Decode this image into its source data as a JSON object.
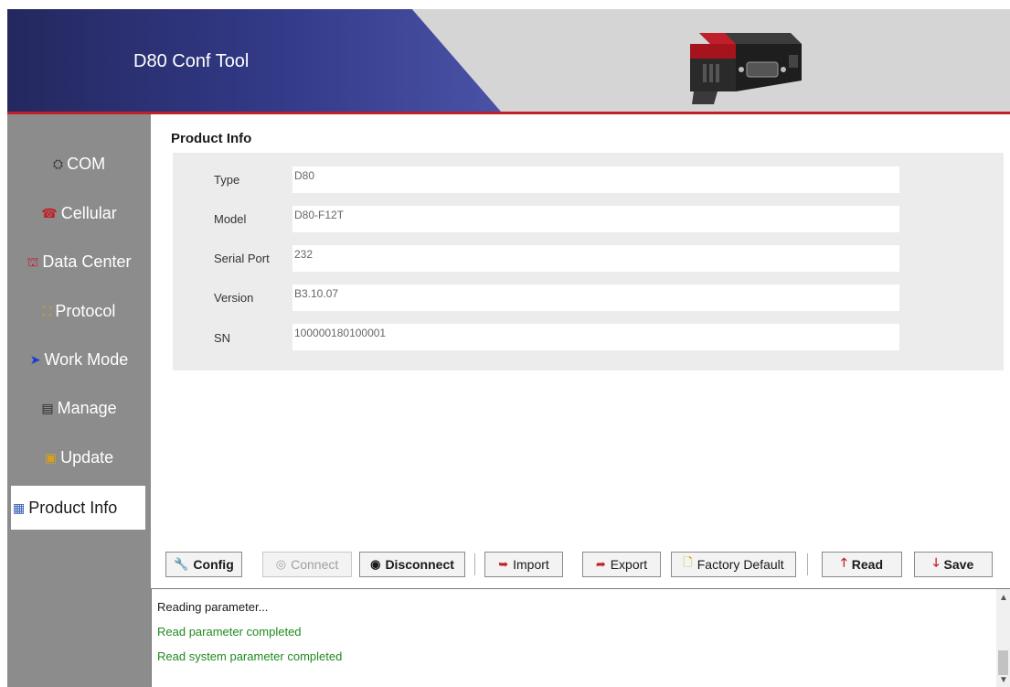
{
  "app": {
    "title": "D80 Conf Tool"
  },
  "colors": {
    "accent": "#c0202a",
    "header_blue": "#333a88",
    "sidebar": "#8c8c8c",
    "log_ok": "#1f8a1f"
  },
  "sidebar": {
    "items": [
      {
        "label": "COM",
        "icon": "com-icon",
        "glyph": "⛭",
        "color": "#3a3a3a"
      },
      {
        "label": "Cellular",
        "icon": "phone-icon",
        "glyph": "☎",
        "color": "#c0202a"
      },
      {
        "label": "Data Center",
        "icon": "network-icon",
        "glyph": "⛫",
        "color": "#c0202a"
      },
      {
        "label": "Protocol",
        "icon": "protocol-icon",
        "glyph": "⛶",
        "color": "#d6a020"
      },
      {
        "label": "Work Mode",
        "icon": "arrow-icon",
        "glyph": "➤",
        "color": "#1a3ad6"
      },
      {
        "label": "Manage",
        "icon": "manage-icon",
        "glyph": "▤",
        "color": "#2a2a2a"
      },
      {
        "label": "Update",
        "icon": "update-icon",
        "glyph": "▣",
        "color": "#d6a020"
      },
      {
        "label": "Product Info",
        "icon": "product-info-icon",
        "glyph": "▦",
        "color": "#2a5ab0",
        "active": true
      }
    ]
  },
  "product_info": {
    "title": "Product Info",
    "fields": [
      {
        "label": "Type",
        "value": "D80"
      },
      {
        "label": "Model",
        "value": "D80-F12T"
      },
      {
        "label": "Serial Port",
        "value": "232"
      },
      {
        "label": "Version",
        "value": "B3.10.07"
      },
      {
        "label": "SN",
        "value": "100000180100001"
      }
    ]
  },
  "toolbar": {
    "config": "Config",
    "connect": "Connect",
    "disconnect": "Disconnect",
    "import": "Import",
    "export": "Export",
    "factory_default": "Factory Default",
    "read": "Read",
    "save": "Save"
  },
  "log": {
    "lines": [
      {
        "text": "Reading parameter...",
        "status": "info"
      },
      {
        "text": "Read parameter completed",
        "status": "ok"
      },
      {
        "text": "Read system parameter completed",
        "status": "ok"
      }
    ]
  }
}
